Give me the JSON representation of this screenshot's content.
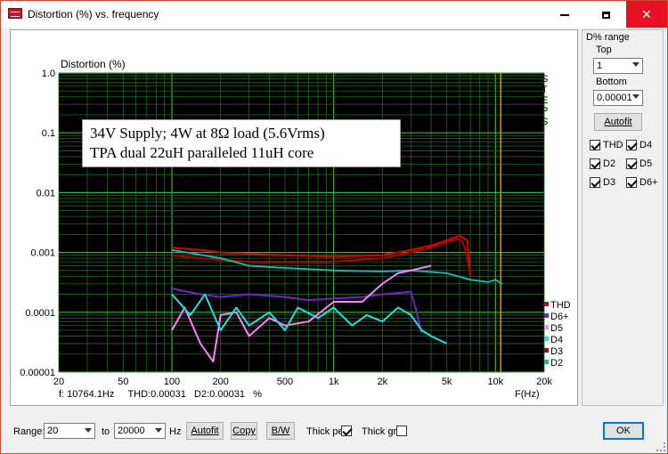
{
  "window": {
    "title": "Distortion (%) vs. frequency",
    "minimize": "minimize",
    "maximize": "maximize",
    "close": "✕"
  },
  "plot": {
    "ylabel": "Distortion (%)",
    "xlabel": "F(Hz)",
    "steps_label": [
      "S",
      "T",
      "E",
      "P",
      "S"
    ],
    "cursor_readout": "f: 10764.1Hz     THD:0.00031   D2:0.00031   %",
    "note_line1": "34V Supply; 4W at 8Ω load (5.6Vrms)",
    "note_line2": "TPA dual 22uH paralleled  11uH core",
    "legend": [
      {
        "name": "THD",
        "color": "#e00000"
      },
      {
        "name": "D6+",
        "color": "#7a20c8"
      },
      {
        "name": "D5",
        "color": "#ff80ff"
      },
      {
        "name": "D4",
        "color": "#20e0e0"
      },
      {
        "name": "D3",
        "color": "#b00000"
      },
      {
        "name": "D2",
        "color": "#20b0b0"
      }
    ]
  },
  "chart_data": {
    "type": "line",
    "title": "",
    "xlabel": "F(Hz)",
    "ylabel": "Distortion (%)",
    "xscale": "log",
    "yscale": "log",
    "xlim": [
      20,
      20000
    ],
    "ylim": [
      1e-05,
      1.0
    ],
    "x_ticks": [
      "20",
      "50",
      "100",
      "200",
      "500",
      "1k",
      "2k",
      "5k",
      "10k",
      "20k"
    ],
    "y_ticks": [
      "1.0",
      "0.1",
      "0.01",
      "0.001",
      "0.0001",
      "0.00001"
    ],
    "cursor_x": 10764.1,
    "series": [
      {
        "name": "THD",
        "color": "#e00000",
        "points": [
          [
            100,
            0.0012
          ],
          [
            150,
            0.0011
          ],
          [
            200,
            0.001
          ],
          [
            300,
            0.00095
          ],
          [
            500,
            0.0009
          ],
          [
            1000,
            0.00085
          ],
          [
            2000,
            0.0009
          ],
          [
            3000,
            0.0011
          ],
          [
            4000,
            0.0013
          ],
          [
            5000,
            0.0016
          ],
          [
            6000,
            0.0019
          ],
          [
            6700,
            0.0016
          ],
          [
            7000,
            0.0004
          ]
        ]
      },
      {
        "name": "D3",
        "color": "#b00000",
        "points": [
          [
            100,
            0.0009
          ],
          [
            150,
            0.0008
          ],
          [
            200,
            0.00075
          ],
          [
            300,
            0.0007
          ],
          [
            500,
            0.0007
          ],
          [
            1000,
            0.0007
          ],
          [
            2000,
            0.0008
          ],
          [
            3000,
            0.001
          ],
          [
            4000,
            0.0012
          ],
          [
            5000,
            0.0015
          ],
          [
            6000,
            0.0017
          ],
          [
            6500,
            0.0012
          ],
          [
            7000,
            0.0004
          ]
        ]
      },
      {
        "name": "D2",
        "color": "#20b0b0",
        "points": [
          [
            100,
            0.0011
          ],
          [
            200,
            0.0008
          ],
          [
            300,
            0.0006
          ],
          [
            500,
            0.00055
          ],
          [
            1000,
            0.0005
          ],
          [
            2000,
            0.00048
          ],
          [
            3000,
            0.0005
          ],
          [
            5000,
            0.00045
          ],
          [
            7000,
            0.00035
          ],
          [
            9000,
            0.00032
          ],
          [
            10000,
            0.00035
          ],
          [
            11000,
            0.0003
          ]
        ]
      },
      {
        "name": "D6+",
        "color": "#7a20c8",
        "points": [
          [
            100,
            0.00025
          ],
          [
            150,
            0.0002
          ],
          [
            200,
            0.00018
          ],
          [
            300,
            0.0002
          ],
          [
            500,
            0.00018
          ],
          [
            700,
            0.00016
          ],
          [
            1000,
            0.00017
          ],
          [
            1500,
            0.00018
          ],
          [
            2000,
            0.0002
          ],
          [
            2500,
            0.00021
          ],
          [
            3000,
            0.00022
          ],
          [
            3200,
            0.00012
          ],
          [
            3500,
            4.5e-05
          ]
        ]
      },
      {
        "name": "D5",
        "color": "#ff80ff",
        "points": [
          [
            100,
            5e-05
          ],
          [
            120,
            0.00012
          ],
          [
            150,
            3e-05
          ],
          [
            180,
            1.5e-05
          ],
          [
            200,
            9e-05
          ],
          [
            250,
            0.0001
          ],
          [
            300,
            4e-05
          ],
          [
            400,
            8e-05
          ],
          [
            500,
            6e-05
          ],
          [
            700,
            7e-05
          ],
          [
            1000,
            0.00015
          ],
          [
            1500,
            0.00015
          ],
          [
            2000,
            0.0003
          ],
          [
            2500,
            0.00045
          ],
          [
            3000,
            0.0005
          ],
          [
            4000,
            0.0006
          ]
        ]
      },
      {
        "name": "D4",
        "color": "#20e0e0",
        "points": [
          [
            100,
            0.0002
          ],
          [
            130,
            9e-05
          ],
          [
            160,
            0.0002
          ],
          [
            200,
            5e-05
          ],
          [
            250,
            0.00012
          ],
          [
            300,
            6e-05
          ],
          [
            400,
            0.0001
          ],
          [
            500,
            5e-05
          ],
          [
            600,
            0.00012
          ],
          [
            800,
            8e-05
          ],
          [
            1000,
            0.00012
          ],
          [
            1300,
            6e-05
          ],
          [
            1600,
            9e-05
          ],
          [
            2000,
            7e-05
          ],
          [
            2500,
            0.00012
          ],
          [
            3000,
            9e-05
          ],
          [
            3500,
            5e-05
          ],
          [
            4000,
            4e-05
          ],
          [
            5000,
            3e-05
          ]
        ]
      }
    ]
  },
  "sidepanel": {
    "title": "D% range",
    "top_label": "Top",
    "top_value": "1",
    "bottom_label": "Bottom",
    "bottom_value": "0.00001",
    "autofit": "Autofit",
    "checks": [
      {
        "label": "THD",
        "checked": true
      },
      {
        "label": "D4",
        "checked": true
      },
      {
        "label": "D2",
        "checked": true
      },
      {
        "label": "D5",
        "checked": true
      },
      {
        "label": "D3",
        "checked": true
      },
      {
        "label": "D6+",
        "checked": true
      }
    ]
  },
  "bottombar": {
    "range_label": "Range:",
    "range_from": "20",
    "to_label": "to",
    "range_to": "20000",
    "hz_label": "Hz",
    "autofit": "Autofit",
    "copy": "Copy",
    "bw": "B/W",
    "thick_pen_label": "Thick pen",
    "thick_pen_checked": true,
    "thick_grid_label": "Thick grid",
    "thick_grid_checked": false,
    "ok": "OK"
  }
}
